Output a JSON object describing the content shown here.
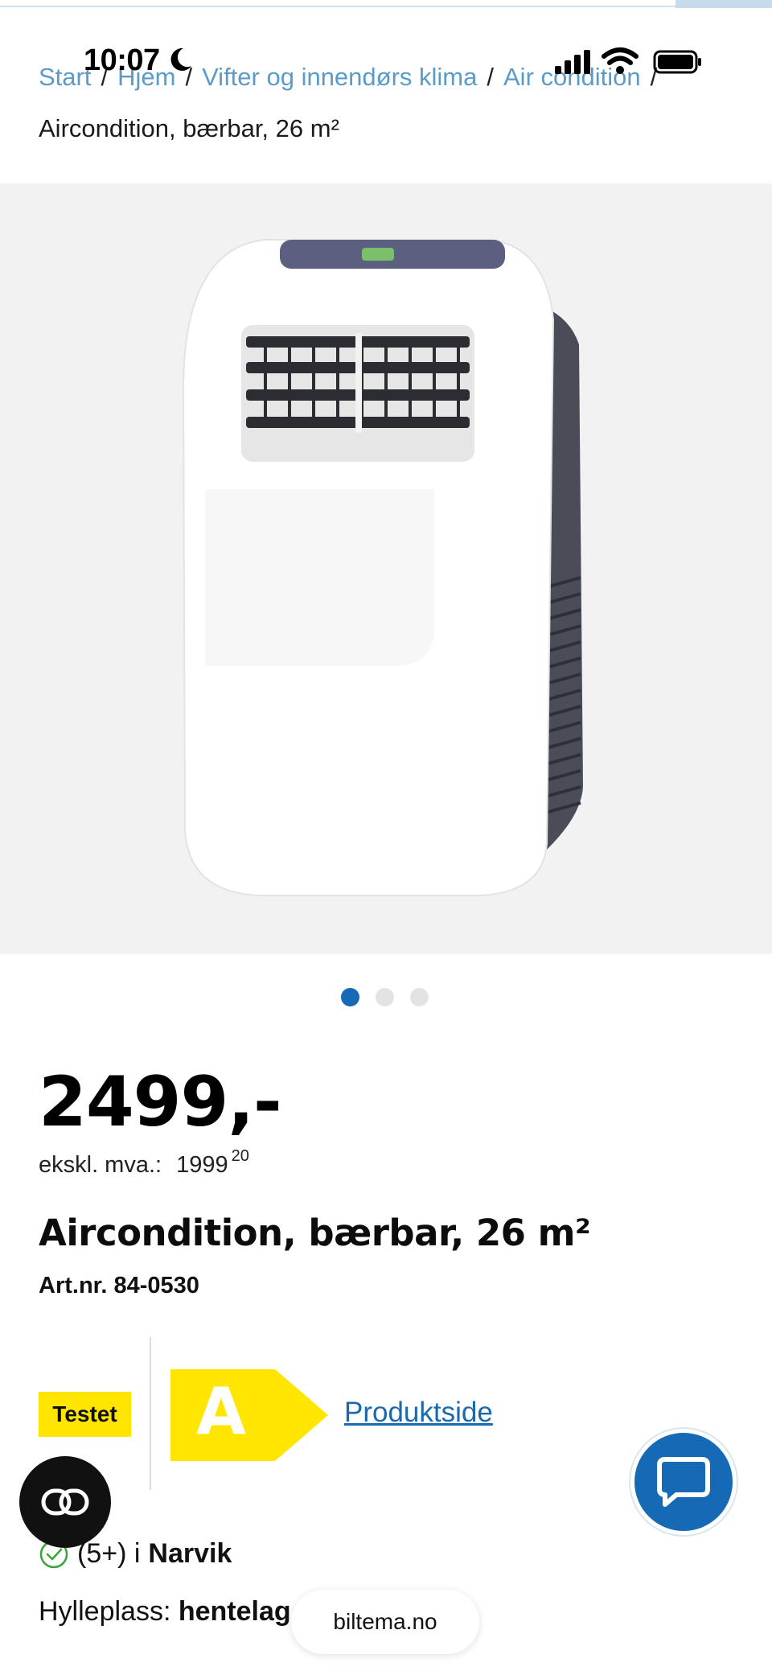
{
  "status_bar": {
    "time": "10:07"
  },
  "breadcrumb": {
    "items": [
      {
        "label": "Start"
      },
      {
        "label": "Hjem"
      },
      {
        "label": "Vifter og innendørs klima"
      },
      {
        "label": "Air condition"
      }
    ],
    "current": "Aircondition, bærbar, 26 m²"
  },
  "gallery": {
    "image_count": 3,
    "active_index": 0
  },
  "product": {
    "price": "2499,-",
    "ex_vat_label": "ekskl. mva.:",
    "ex_vat_main": "1999",
    "ex_vat_cents": "20",
    "title": "Aircondition, bærbar, 26 m²",
    "art_nr": "Art.nr. 84-0530",
    "tested_badge": "Testet",
    "energy_class": "A",
    "energy_color": "#ffe600",
    "product_page_link": "Produktside"
  },
  "stock": {
    "count": "(5+) i",
    "store": "Narvik",
    "shelf_label": "Hylleplass:",
    "shelf_value": "hentelag"
  },
  "browser": {
    "url": "biltema.no"
  },
  "colors": {
    "accent": "#1569b5",
    "link": "#5a9bc8"
  }
}
